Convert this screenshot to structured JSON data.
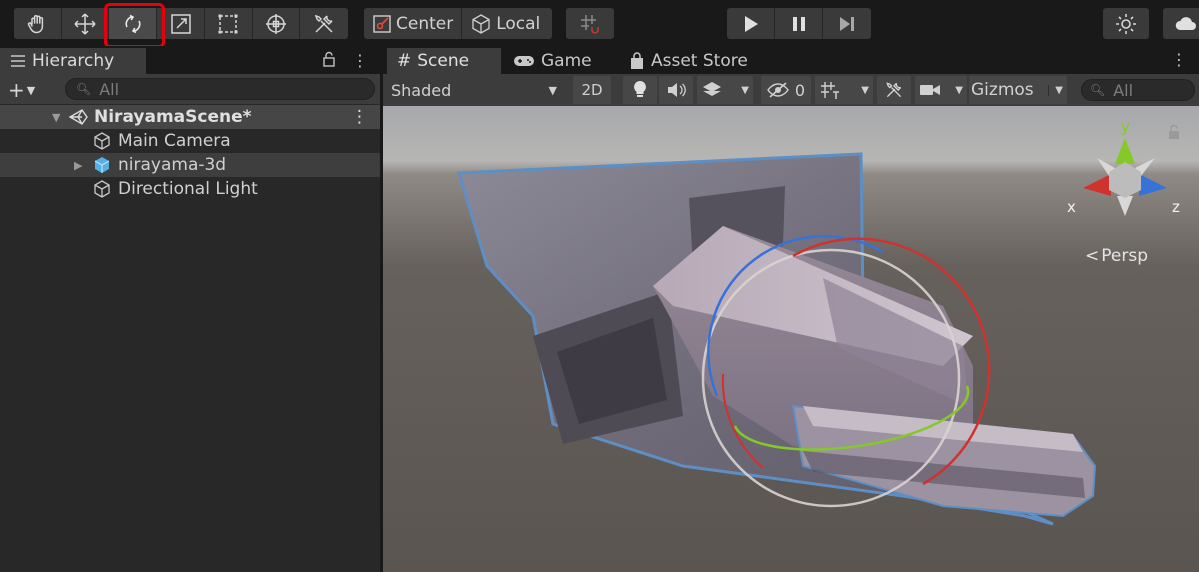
{
  "toolbar": {
    "tools": [
      {
        "name": "hand-tool",
        "icon": "hand-icon"
      },
      {
        "name": "move-tool",
        "icon": "move-icon"
      },
      {
        "name": "rotate-tool",
        "icon": "rotate-icon",
        "active": true
      },
      {
        "name": "scale-tool",
        "icon": "scale-icon"
      },
      {
        "name": "rect-tool",
        "icon": "rect-icon"
      },
      {
        "name": "transform-tool",
        "icon": "transform-icon"
      },
      {
        "name": "custom-tool",
        "icon": "tools-icon"
      }
    ],
    "pivot_label": "Center",
    "space_label": "Local",
    "highlight_color": "#e3000f"
  },
  "hierarchy": {
    "tab_label": "Hierarchy",
    "search_placeholder": "All",
    "scene_name": "NirayamaScene*",
    "items": [
      {
        "label": "Main Camera",
        "icon": "gameobject-icon"
      },
      {
        "label": "nirayama-3d",
        "icon": "prefab-icon",
        "expandable": true
      },
      {
        "label": "Directional Light",
        "icon": "gameobject-icon"
      }
    ]
  },
  "scene": {
    "tabs": [
      {
        "label": "Scene",
        "icon": "grid-icon",
        "active": true
      },
      {
        "label": "Game",
        "icon": "gamepad-icon"
      },
      {
        "label": "Asset Store",
        "icon": "bag-icon"
      }
    ],
    "shading_mode": "Shaded",
    "mode_2d": "2D",
    "hidden_count": "0",
    "gizmos_label": "Gizmos",
    "search_placeholder": "All",
    "projection_label": "Persp",
    "axis_labels": {
      "x": "x",
      "y": "y",
      "z": "z"
    },
    "axis_colors": {
      "x": "#d0322d",
      "y": "#84c928",
      "z": "#3772d8"
    }
  }
}
